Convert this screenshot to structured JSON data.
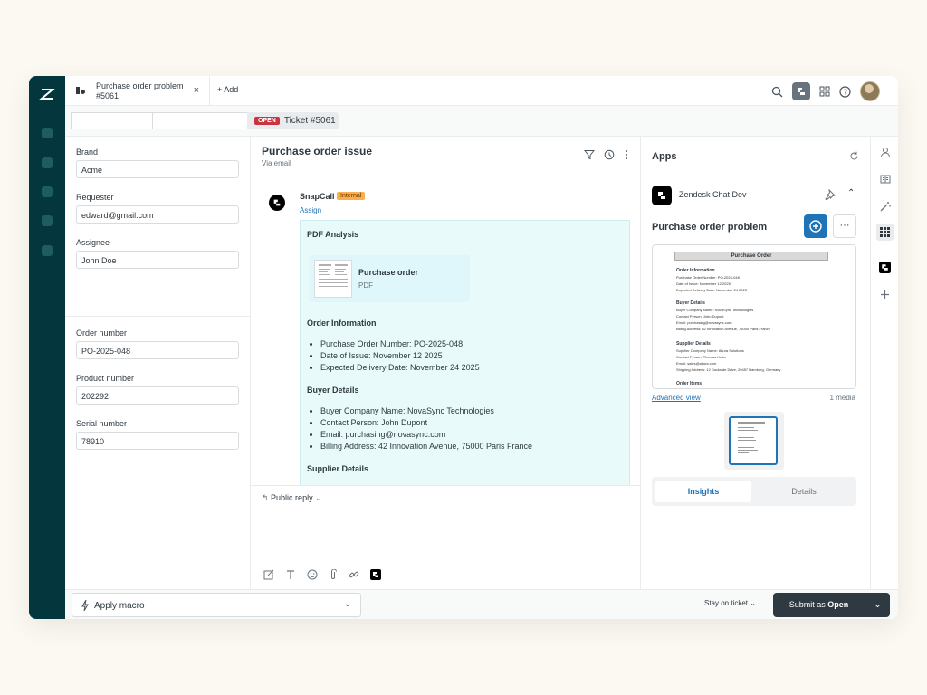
{
  "tab": {
    "title": "Purchase order problem #5061",
    "close": "×",
    "add": "+ Add"
  },
  "subbar": {
    "status": "OPEN",
    "ticket": "Ticket #5061"
  },
  "fields": {
    "brand_label": "Brand",
    "brand_value": "Acme",
    "requester_label": "Requester",
    "requester_value": "edward@gmail.com",
    "assignee_label": "Assignee",
    "assignee_value": "John Doe",
    "order_label": "Order number",
    "order_value": "PO-2025-048",
    "product_label": "Product number",
    "product_value": "202292",
    "serial_label": "Serial number",
    "serial_value": "78910"
  },
  "conversation": {
    "title": "Purchase order issue",
    "channel": "Via email",
    "author": "SnapCall",
    "author_badge": "Internal",
    "assign": "Assign",
    "heading": "PDF Analysis",
    "attachment_title": "Purchase order",
    "attachment_type": "PDF",
    "order_info_heading": "Order Information",
    "order_info": [
      "Purchase Order Number: PO-2025-048",
      "Date of Issue: November 12 2025",
      "Expected Delivery Date: November 24 2025"
    ],
    "buyer_heading": "Buyer Details",
    "buyer": [
      "Buyer Company Name: NovaSync Technologies",
      "Contact Person: John Dupont",
      "Email: purchasing@novasync.com",
      "Billing Address: 42 Innovation Avenue, 75000 Paris France"
    ],
    "supplier_heading": "Supplier Details"
  },
  "reply": {
    "mode": "Public reply"
  },
  "apps": {
    "title": "Apps",
    "app_name": "Zendesk Chat Dev",
    "panel_title": "Purchase order problem",
    "more": "···",
    "preview": {
      "header": "Purchase Order",
      "order_heading": "Order Information",
      "order_lines": [
        "Purchase Order Number: PO-2025-048",
        "Date of Issue: November 12 2025",
        "Expected Delivery Date: November 24 2025"
      ],
      "buyer_heading": "Buyer Details",
      "buyer_lines": [
        "Buyer Company Name: NovaSync Technologies",
        "Contact Person: John Dupont",
        "Email: purchasing@novasync.com",
        "Billing Address: 42 Innovation Avenue, 75000 Paris France"
      ],
      "supplier_heading": "Supplier Details",
      "supplier_lines": [
        "Supplier Company Name: Altura Solutions",
        "Contact Person: Thomas Keller",
        "Email: sales@altura.com",
        "Shipping Address: 12 Dockside Drive, 20457 Hamburg, Germany"
      ],
      "items_heading": "Order Items"
    },
    "advanced": "Advanced view",
    "media": "1 media",
    "tab_insights": "Insights",
    "tab_details": "Details"
  },
  "bottom": {
    "macro": "Apply macro",
    "stay": "Stay on ticket",
    "submit_prefix": "Submit as ",
    "submit_status": "Open"
  },
  "colors": {
    "nav": "#03363d",
    "accent": "#1f73b7",
    "open_badge": "#cc3340",
    "internal_badge": "#fcae4e",
    "note_bg": "#e8fbfa",
    "submit": "#2f3941"
  }
}
